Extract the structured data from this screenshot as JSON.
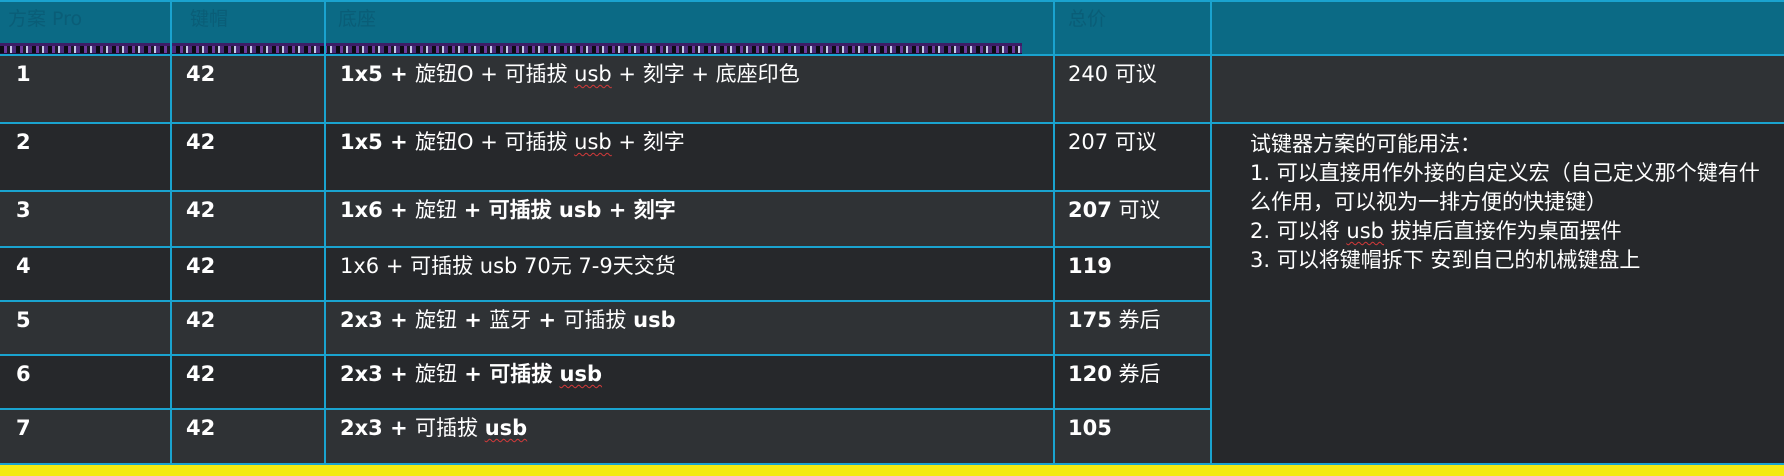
{
  "header": {
    "col1": "方案 Pro",
    "col2": "键帽",
    "col3": "底座",
    "col4": "总价"
  },
  "rows": [
    {
      "no": "1",
      "keys": "42",
      "desc_a": "1x5 + ",
      "desc_b": "旋钮O + 可插拔 ",
      "desc_c": "usb",
      "desc_d": " + 刻字 + 底座印色",
      "price": "240 可议"
    },
    {
      "no": "2",
      "keys": "42",
      "desc_a": "1x5 + ",
      "desc_b": "旋钮O + 可插拔 ",
      "desc_c": "usb",
      "desc_d": " + 刻字",
      "price": "207 可议"
    },
    {
      "no": "3",
      "keys": "42",
      "desc_a": "1x6 + ",
      "desc_b": "旋钮 ",
      "desc_c": " + 可插拔 usb + 刻字",
      "price_a": "207",
      "price_b": " 可议"
    },
    {
      "no": "4",
      "keys": "42",
      "desc": "1x6  + 可插拔 usb 70元 7-9天交货",
      "price": "119"
    },
    {
      "no": "5",
      "keys": "42",
      "desc_a": "2x3 + ",
      "desc_b": "旋钮",
      "desc_c": " + ",
      "desc_d": "蓝牙",
      "desc_e": " + ",
      "desc_f": "可插拔 ",
      "desc_g": "usb",
      "price_a": "175",
      "price_b": " 券后"
    },
    {
      "no": "6",
      "keys": "42",
      "desc_a": "2x3 + ",
      "desc_b": "旋钮",
      "desc_c": " + 可插拔 ",
      "desc_d": "usb",
      "price_a": "120",
      "price_b": " 券后"
    },
    {
      "no": "7",
      "keys": "42",
      "desc_a": "2x3 + ",
      "desc_b": "可插拔 ",
      "desc_c": "usb",
      "price": "105"
    }
  ],
  "notes": {
    "title": "试键器方案的可能用法：",
    "line1": "1. 可以直接用作外接的自定义宏（自己定义那个键有什么作用，可以视为一排方便的快捷键）",
    "line2a": "2. 可以将 ",
    "line2b": "usb",
    "line2c": " 拔掉后直接作为桌面摆件",
    "line3": "3. 可以将键帽拆下 安到自己的机械键盘上"
  }
}
